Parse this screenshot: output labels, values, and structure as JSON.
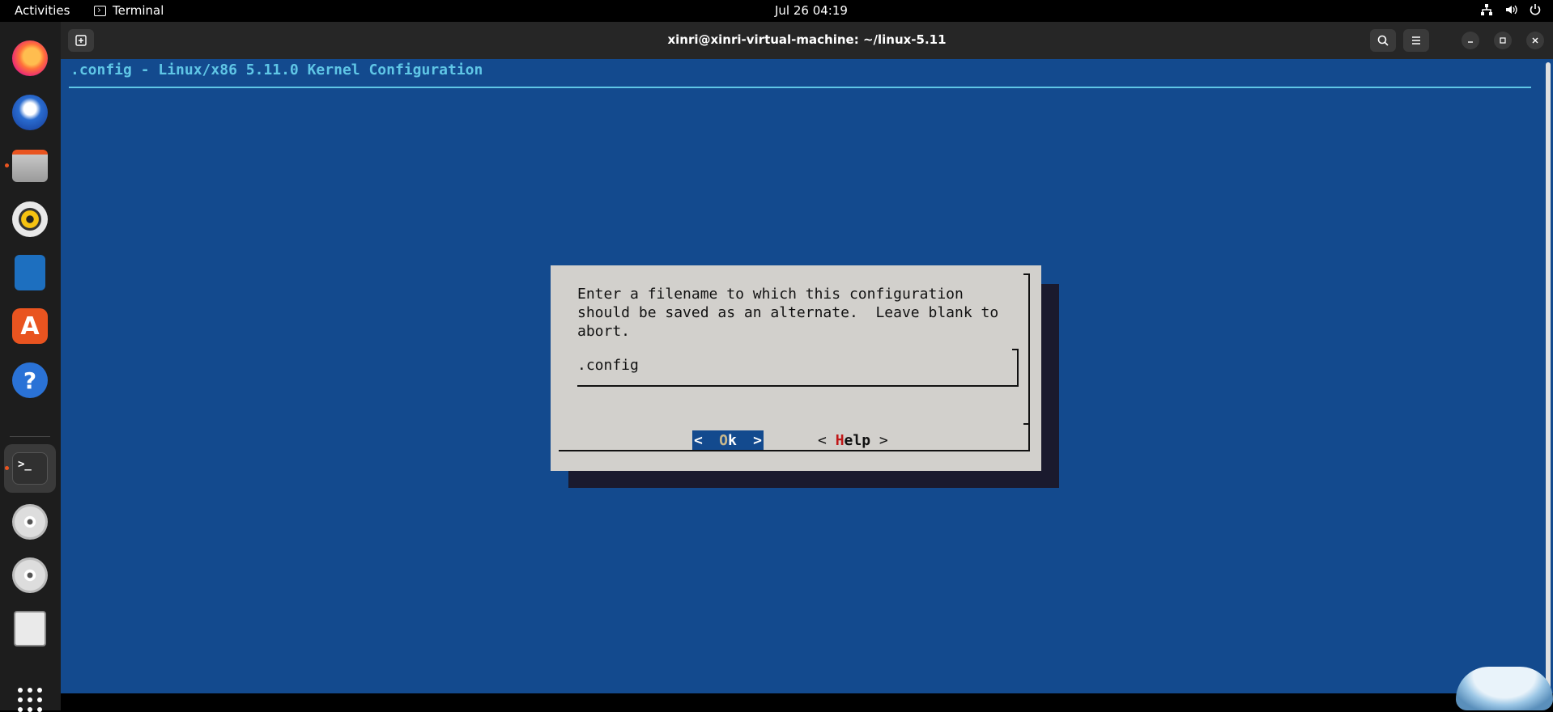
{
  "topbar": {
    "activities": "Activities",
    "app_name": "Terminal",
    "clock": "Jul 26  04:19",
    "tray_icons": [
      "network-icon",
      "volume-icon",
      "power-icon"
    ]
  },
  "dock": {
    "items": [
      {
        "name": "firefox",
        "icon": "firefox-icon"
      },
      {
        "name": "thunderbird",
        "icon": "thunderbird-icon"
      },
      {
        "name": "files",
        "icon": "files-icon"
      },
      {
        "name": "rhythmbox",
        "icon": "rhythmbox-icon"
      },
      {
        "name": "libreoffice-writer",
        "icon": "writer-icon"
      },
      {
        "name": "app-center",
        "icon": "app-center-icon"
      },
      {
        "name": "help",
        "icon": "help-icon"
      },
      {
        "name": "terminal",
        "icon": "terminal-icon"
      },
      {
        "name": "disc-1",
        "icon": "disc-icon"
      },
      {
        "name": "disc-2",
        "icon": "disc-icon"
      },
      {
        "name": "floppy",
        "icon": "floppy-icon"
      }
    ],
    "app_grid": "show-apps-icon"
  },
  "window": {
    "title": "xinri@xinri-virtual-machine: ~/linux-5.11",
    "terminal_glyph": ">_"
  },
  "terminal": {
    "header": ".config - Linux/x86 5.11.0 Kernel Configuration",
    "dialog": {
      "message": "Enter a filename to which this configuration\nshould be saved as an alternate.  Leave blank to\nabort.",
      "input_value": ".config",
      "ok_left": "<",
      "ok_hotkey": "O",
      "ok_rest": "k",
      "ok_right": ">",
      "help_left": "< ",
      "help_hotkey": "H",
      "help_rest": "elp",
      "help_right": " >"
    }
  },
  "colors": {
    "terminal_bg": "#134a8e",
    "header_fg": "#5fc6e6",
    "dialog_bg": "#d2d0cc",
    "hotkey_red": "#c01818"
  }
}
